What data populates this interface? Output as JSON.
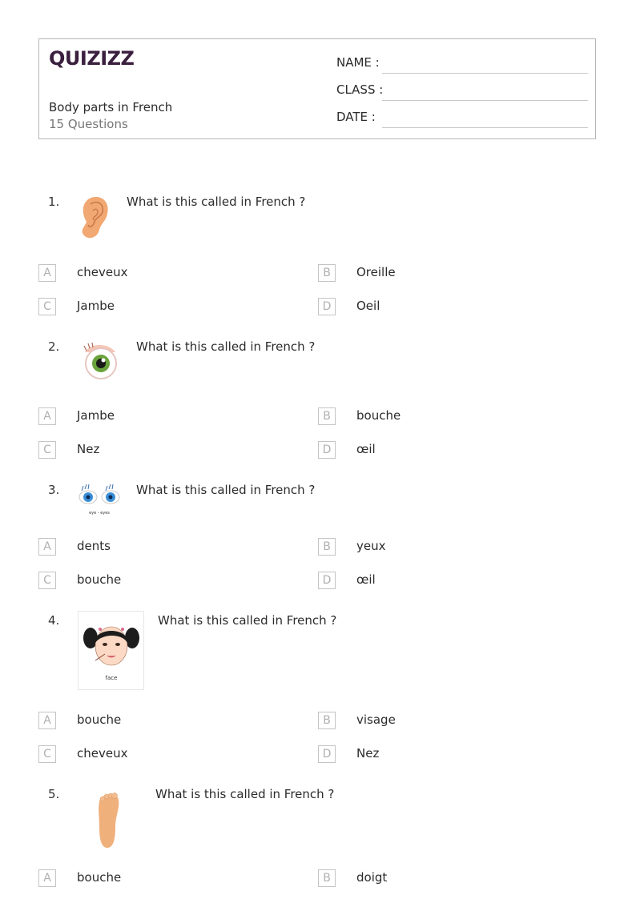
{
  "header": {
    "logo": "QUIZIZZ",
    "title": "Body parts in French",
    "question_count": "15 Questions",
    "fields": [
      {
        "label": "NAME :"
      },
      {
        "label": "CLASS :"
      },
      {
        "label": "DATE  :"
      }
    ]
  },
  "questions": [
    {
      "number": "1.",
      "image": "ear-image",
      "text": "What is this called in French ?",
      "options": [
        {
          "letter": "A",
          "text": "cheveux"
        },
        {
          "letter": "B",
          "text": "Oreille"
        },
        {
          "letter": "C",
          "text": "Jambe"
        },
        {
          "letter": "D",
          "text": "Oeil"
        }
      ]
    },
    {
      "number": "2.",
      "image": "eye-image",
      "text": "What is this called in French ?",
      "options": [
        {
          "letter": "A",
          "text": "Jambe"
        },
        {
          "letter": "B",
          "text": "bouche"
        },
        {
          "letter": "C",
          "text": "Nez"
        },
        {
          "letter": "D",
          "text": "œil"
        }
      ]
    },
    {
      "number": "3.",
      "image": "eyes-image",
      "image_caption": "eye - eyes",
      "text": "What is this called in French ?",
      "options": [
        {
          "letter": "A",
          "text": "dents"
        },
        {
          "letter": "B",
          "text": "yeux"
        },
        {
          "letter": "C",
          "text": "bouche"
        },
        {
          "letter": "D",
          "text": "œil"
        }
      ]
    },
    {
      "number": "4.",
      "image": "face-image",
      "image_caption": "face",
      "text": "What is this called in French ?",
      "options": [
        {
          "letter": "A",
          "text": "bouche"
        },
        {
          "letter": "B",
          "text": "visage"
        },
        {
          "letter": "C",
          "text": "cheveux"
        },
        {
          "letter": "D",
          "text": "Nez"
        }
      ]
    },
    {
      "number": "5.",
      "image": "foot-image",
      "text": "What is this called in French ?",
      "options": [
        {
          "letter": "A",
          "text": "bouche"
        },
        {
          "letter": "B",
          "text": "doigt"
        }
      ]
    }
  ]
}
